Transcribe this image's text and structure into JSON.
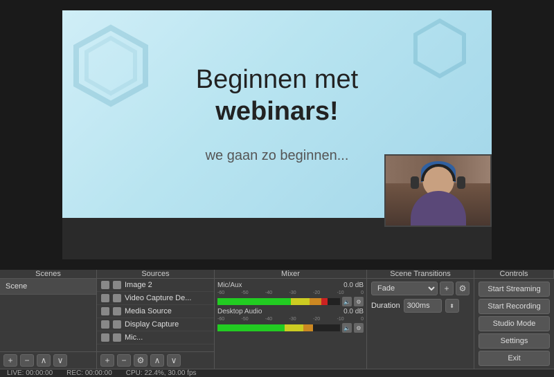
{
  "preview": {
    "slide": {
      "title_part1": "Beginnen met",
      "title_part2": "webinars!",
      "subtitle": "we gaan zo beginnen..."
    }
  },
  "panels": {
    "scenes_header": "Scenes",
    "sources_header": "Sources",
    "mixer_header": "Mixer",
    "transitions_header": "Scene Transitions",
    "controls_header": "Controls"
  },
  "scenes": {
    "item": "Scene"
  },
  "sources": {
    "items": [
      {
        "label": "Image 2"
      },
      {
        "label": "Video Capture De..."
      },
      {
        "label": "Media Source"
      },
      {
        "label": "Display Capture"
      },
      {
        "label": "Mic..."
      }
    ]
  },
  "mixer": {
    "channels": [
      {
        "name": "Mic/Aux",
        "db": "0.0 dB"
      },
      {
        "name": "Desktop Audio",
        "db": "0.0 dB"
      }
    ]
  },
  "transitions": {
    "type": "Fade",
    "duration_label": "Duration",
    "duration_value": "300ms"
  },
  "controls": {
    "start_streaming": "Start Streaming",
    "start_recording": "Start Recording",
    "studio_mode": "Studio Mode",
    "settings": "Settings",
    "exit": "Exit"
  },
  "status": {
    "live": "LIVE: 00:00:00",
    "rec": "REC: 00:00:00",
    "cpu": "CPU: 22.4%, 30.00 fps"
  }
}
